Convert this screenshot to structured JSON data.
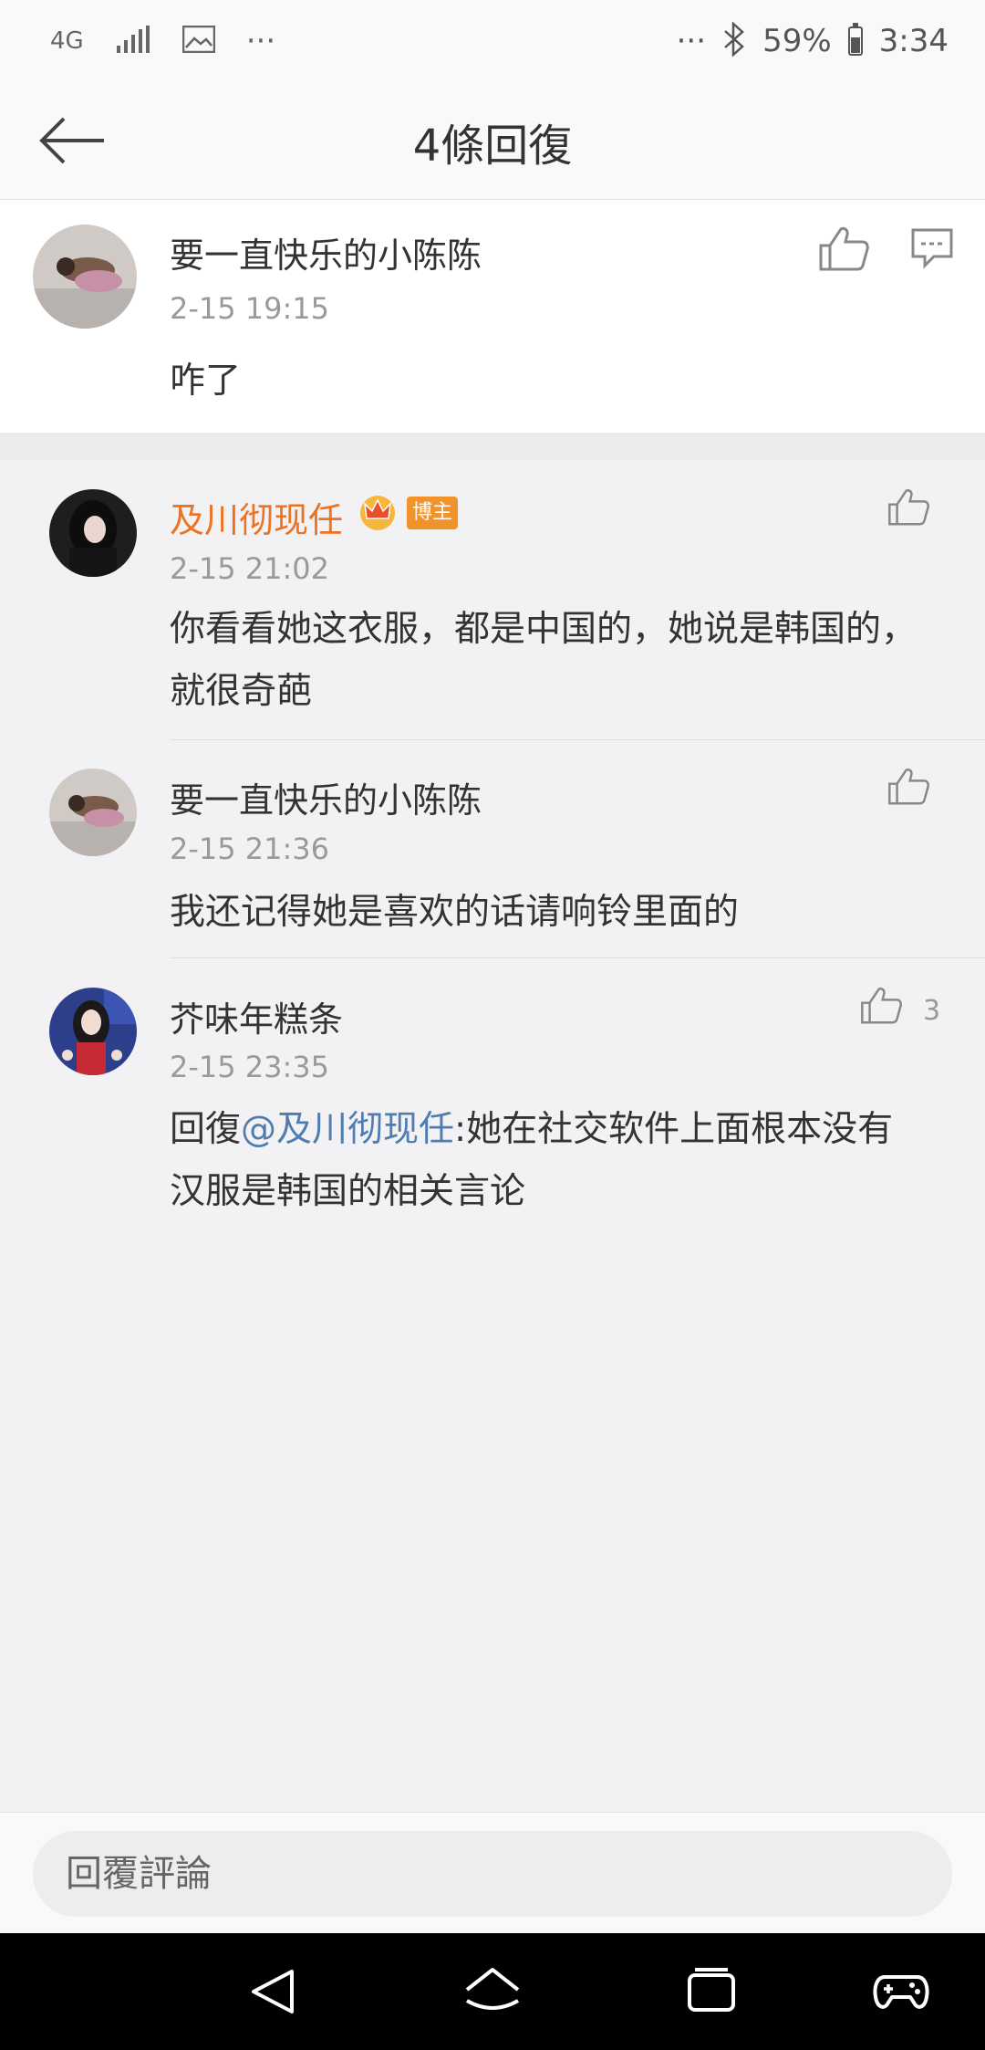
{
  "status_bar": {
    "network": "4G",
    "more": "···",
    "right_more": "···",
    "battery": "59%",
    "time": "3:34"
  },
  "header": {
    "title": "4條回復"
  },
  "main_comment": {
    "author": "要一直快乐的小陈陈",
    "time": "2-15 19:15",
    "text": "咋了"
  },
  "replies": [
    {
      "author": "及川彻现任",
      "badge": "博主",
      "time": "2-15 21:02",
      "text": "你看看她这衣服，都是中国的，她说是韩国的，就很奇葩",
      "likes": ""
    },
    {
      "author": "要一直快乐的小陈陈",
      "time": "2-15 21:36",
      "text": "我还记得她是喜欢的话请响铃里面的",
      "likes": ""
    },
    {
      "author": "芥味年糕条",
      "time": "2-15 23:35",
      "reply_prefix": "回復",
      "mention": "@及川彻现任",
      "text": ":她在社交软件上面根本没有汉服是韩国的相关言论",
      "likes": "3"
    }
  ],
  "reply_bar": {
    "placeholder": "回覆評論"
  },
  "colors": {
    "accent_orange": "#eb7322",
    "mention_blue": "#507daf",
    "badge_orange": "#f0932b"
  }
}
